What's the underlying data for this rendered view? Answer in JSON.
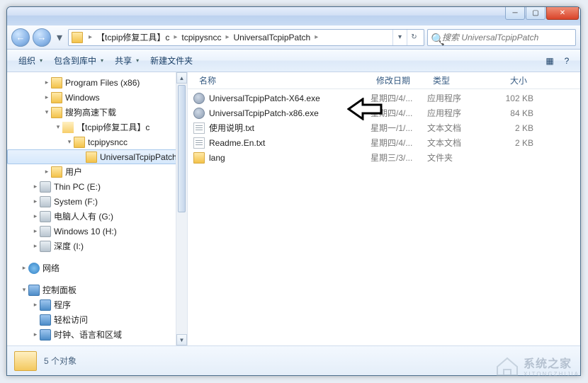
{
  "titlebar": {
    "min": "─",
    "max": "▢",
    "close": "✕"
  },
  "nav": {
    "back": "←",
    "fwd": "→"
  },
  "breadcrumb": {
    "items": [
      "【tcpip修复工具】c",
      "tcpipysncc",
      "UniversalTcpipPatch"
    ],
    "sep": "▸"
  },
  "search": {
    "placeholder": "搜索 UniversalTcpipPatch",
    "icon": "🔍"
  },
  "toolbar": {
    "organize": "组织",
    "include": "包含到库中",
    "share": "共享",
    "newfolder": "新建文件夹",
    "view_icon": "▦",
    "help_icon": "?"
  },
  "tree": [
    {
      "depth": 2,
      "exp": "▸",
      "icon": "fold",
      "label": "Program Files (x86)"
    },
    {
      "depth": 2,
      "exp": "▸",
      "icon": "fold",
      "label": "Windows"
    },
    {
      "depth": 2,
      "exp": "▾",
      "icon": "fold",
      "label": "搜狗高速下载"
    },
    {
      "depth": 3,
      "exp": "▾",
      "icon": "fold-open",
      "label": "【tcpip修复工具】c"
    },
    {
      "depth": 4,
      "exp": "▾",
      "icon": "fold",
      "label": "tcpipysncc"
    },
    {
      "depth": 5,
      "exp": "",
      "icon": "fold",
      "label": "UniversalTcpipPatch",
      "sel": true
    },
    {
      "depth": 2,
      "exp": "▸",
      "icon": "fold",
      "label": "用户"
    },
    {
      "depth": 1,
      "exp": "▸",
      "icon": "drv",
      "label": "Thin PC (E:)"
    },
    {
      "depth": 1,
      "exp": "▸",
      "icon": "drv",
      "label": "System (F:)"
    },
    {
      "depth": 1,
      "exp": "▸",
      "icon": "drv",
      "label": "电脑人人有 (G:)"
    },
    {
      "depth": 1,
      "exp": "▸",
      "icon": "drv",
      "label": "Windows 10 (H:)"
    },
    {
      "depth": 1,
      "exp": "▸",
      "icon": "drv",
      "label": "深度 (I:)"
    },
    {
      "depth": 0,
      "exp": "",
      "icon": "",
      "label": "",
      "spacer": true
    },
    {
      "depth": 0,
      "exp": "▸",
      "icon": "net",
      "label": "网络"
    },
    {
      "depth": 0,
      "exp": "",
      "icon": "",
      "label": "",
      "spacer": true
    },
    {
      "depth": 0,
      "exp": "▾",
      "icon": "cpl",
      "label": "控制面板"
    },
    {
      "depth": 1,
      "exp": "▸",
      "icon": "cpl",
      "label": "程序"
    },
    {
      "depth": 1,
      "exp": "",
      "icon": "cpl",
      "label": "轻松访问"
    },
    {
      "depth": 1,
      "exp": "▸",
      "icon": "cpl",
      "label": "时钟、语言和区域"
    }
  ],
  "columns": {
    "name": "名称",
    "date": "修改日期",
    "type": "类型",
    "size": "大小"
  },
  "files": [
    {
      "icon": "exe",
      "name": "UniversalTcpipPatch-X64.exe",
      "date": "星期四/4/...",
      "type": "应用程序",
      "size": "102 KB"
    },
    {
      "icon": "exe",
      "name": "UniversalTcpipPatch-x86.exe",
      "date": "星期四/4/...",
      "type": "应用程序",
      "size": "84 KB"
    },
    {
      "icon": "txt",
      "name": "使用说明.txt",
      "date": "星期一/1/...",
      "type": "文本文档",
      "size": "2 KB"
    },
    {
      "icon": "txt",
      "name": "Readme.En.txt",
      "date": "星期四/4/...",
      "type": "文本文档",
      "size": "2 KB"
    },
    {
      "icon": "fold",
      "name": "lang",
      "date": "星期三/3/...",
      "type": "文件夹",
      "size": ""
    }
  ],
  "status": {
    "text": "5 个对象"
  },
  "watermark": {
    "text": "系统之家",
    "sub": "XITONGZHIJIA"
  }
}
